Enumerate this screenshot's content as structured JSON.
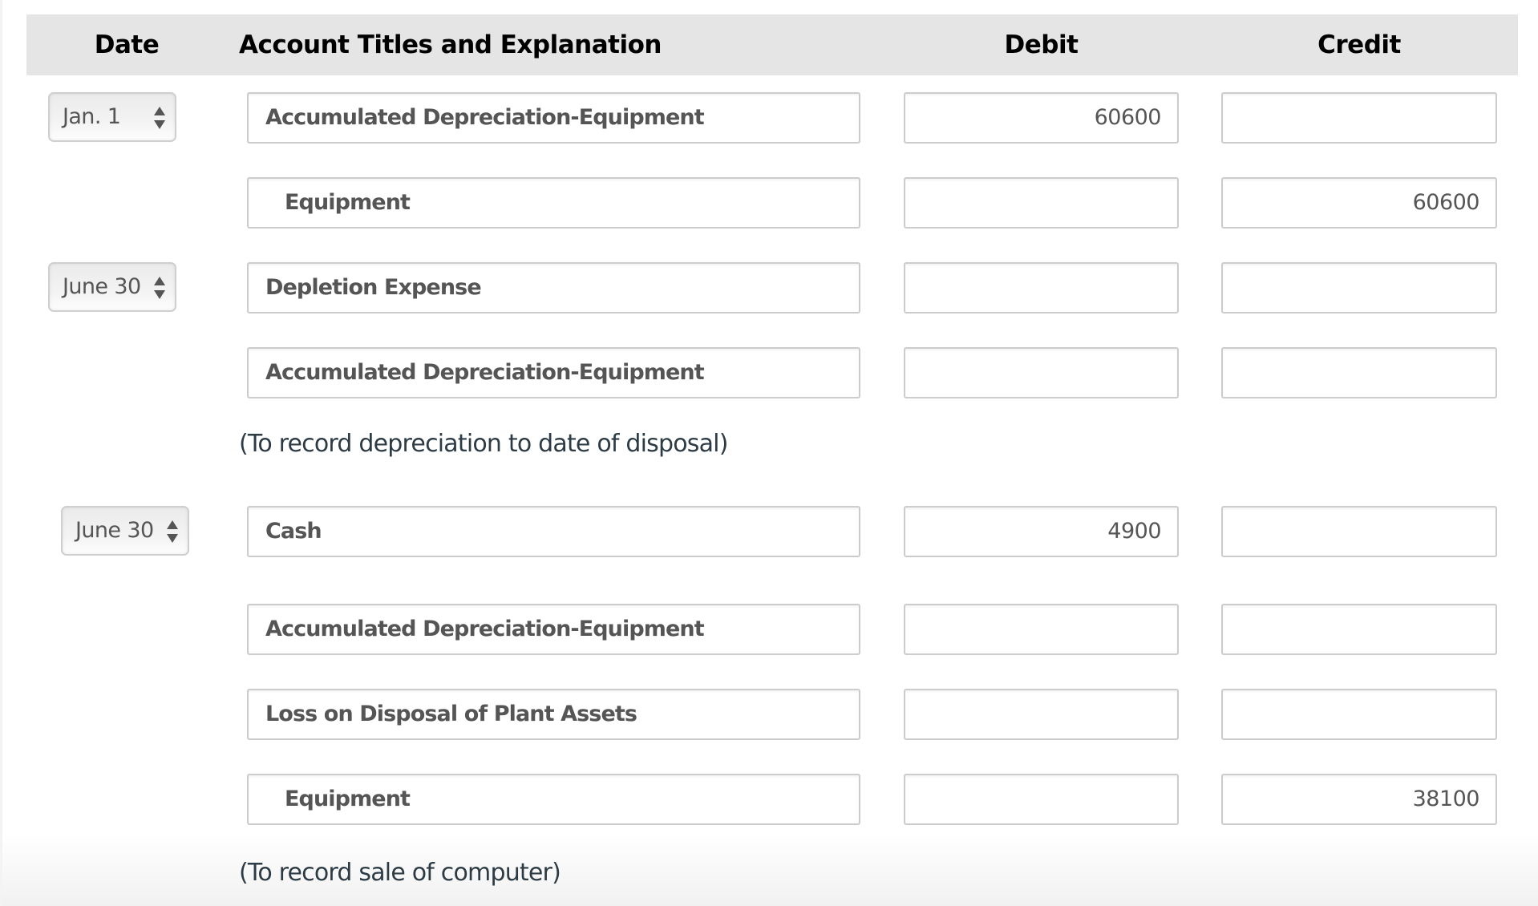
{
  "header": {
    "date": "Date",
    "account": "Account Titles and Explanation",
    "debit": "Debit",
    "credit": "Credit"
  },
  "entries": [
    {
      "date": "Jan. 1",
      "lines": [
        {
          "account": "Accumulated Depreciation-Equipment",
          "debit": "60600",
          "credit": ""
        },
        {
          "account": "Equipment",
          "debit": "",
          "credit": "60600"
        }
      ],
      "note": ""
    },
    {
      "date": "June 30",
      "lines": [
        {
          "account": "Depletion Expense",
          "debit": "",
          "credit": ""
        },
        {
          "account": "Accumulated Depreciation-Equipment",
          "debit": "",
          "credit": ""
        }
      ],
      "note": "(To record depreciation to date of disposal)"
    },
    {
      "date": "June 30",
      "lines": [
        {
          "account": "Cash",
          "debit": "4900",
          "credit": ""
        },
        {
          "account": "Accumulated Depreciation-Equipment",
          "debit": "",
          "credit": ""
        },
        {
          "account": "Loss on Disposal of Plant Assets",
          "debit": "",
          "credit": ""
        },
        {
          "account": "Equipment",
          "debit": "",
          "credit": "38100"
        }
      ],
      "note": "(To record sale of computer)"
    }
  ],
  "icons": {
    "select_arrows": "up-down-arrows-icon"
  }
}
